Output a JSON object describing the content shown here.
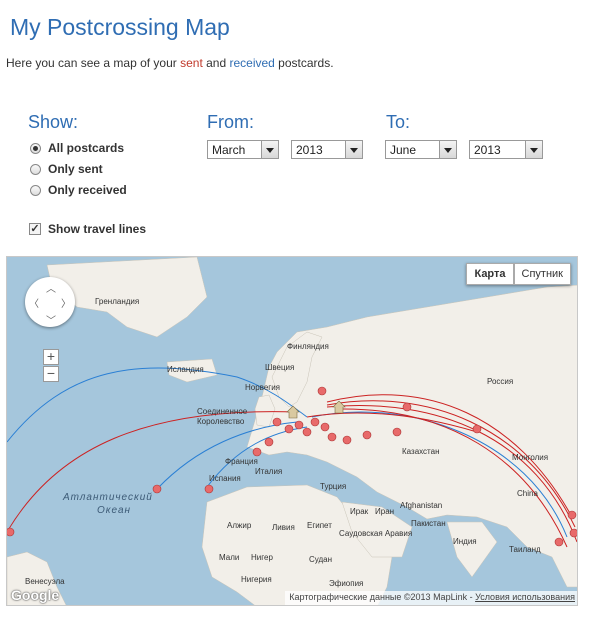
{
  "page": {
    "title": "My Postcrossing Map",
    "intro": {
      "before": "Here you can see a map of your ",
      "sent_word": "sent",
      "middle": " and ",
      "received_word": "received",
      "after": " postcards."
    }
  },
  "filters": {
    "show_label": "Show:",
    "options": [
      {
        "label": "All postcards",
        "selected": true
      },
      {
        "label": "Only sent",
        "selected": false
      },
      {
        "label": "Only received",
        "selected": false
      }
    ],
    "from_label": "From:",
    "to_label": "To:",
    "from_month": "March",
    "from_year": "2013",
    "to_month": "June",
    "to_year": "2013",
    "travel_lines_label": "Show travel lines",
    "travel_lines_checked": true
  },
  "map": {
    "type_buttons": [
      {
        "label": "Карта",
        "active": true
      },
      {
        "label": "Спутник",
        "active": false
      }
    ],
    "zoom_in": "+",
    "zoom_out": "−",
    "labels": [
      "Гренландия",
      "Финляндия",
      "Исландия",
      "Швеция",
      "Норвегия",
      "Соединенное Королевство",
      "Россия",
      "Казахстан",
      "Монголия",
      "Франция",
      "Италия",
      "Испания",
      "Турция",
      "Атлантический",
      "Океан",
      "Afghanistan",
      "China",
      "Ирак",
      "Иран",
      "Пакистан",
      "Алжир",
      "Ливия",
      "Египет",
      "Саудовская Аравия",
      "Индия",
      "Таиланд",
      "Мали",
      "Нигер",
      "Судан",
      "Нигерия",
      "Эфиопия",
      "Венесуэла"
    ],
    "attribution": "Картографические данные ©2013 MapLink - ",
    "terms_link": "Условия использования",
    "logo": "Google",
    "colors": {
      "water": "#a5c6dc",
      "land": "#f2efe9",
      "sent_line": "#cc2222",
      "received_line": "#2a7fd4"
    }
  }
}
